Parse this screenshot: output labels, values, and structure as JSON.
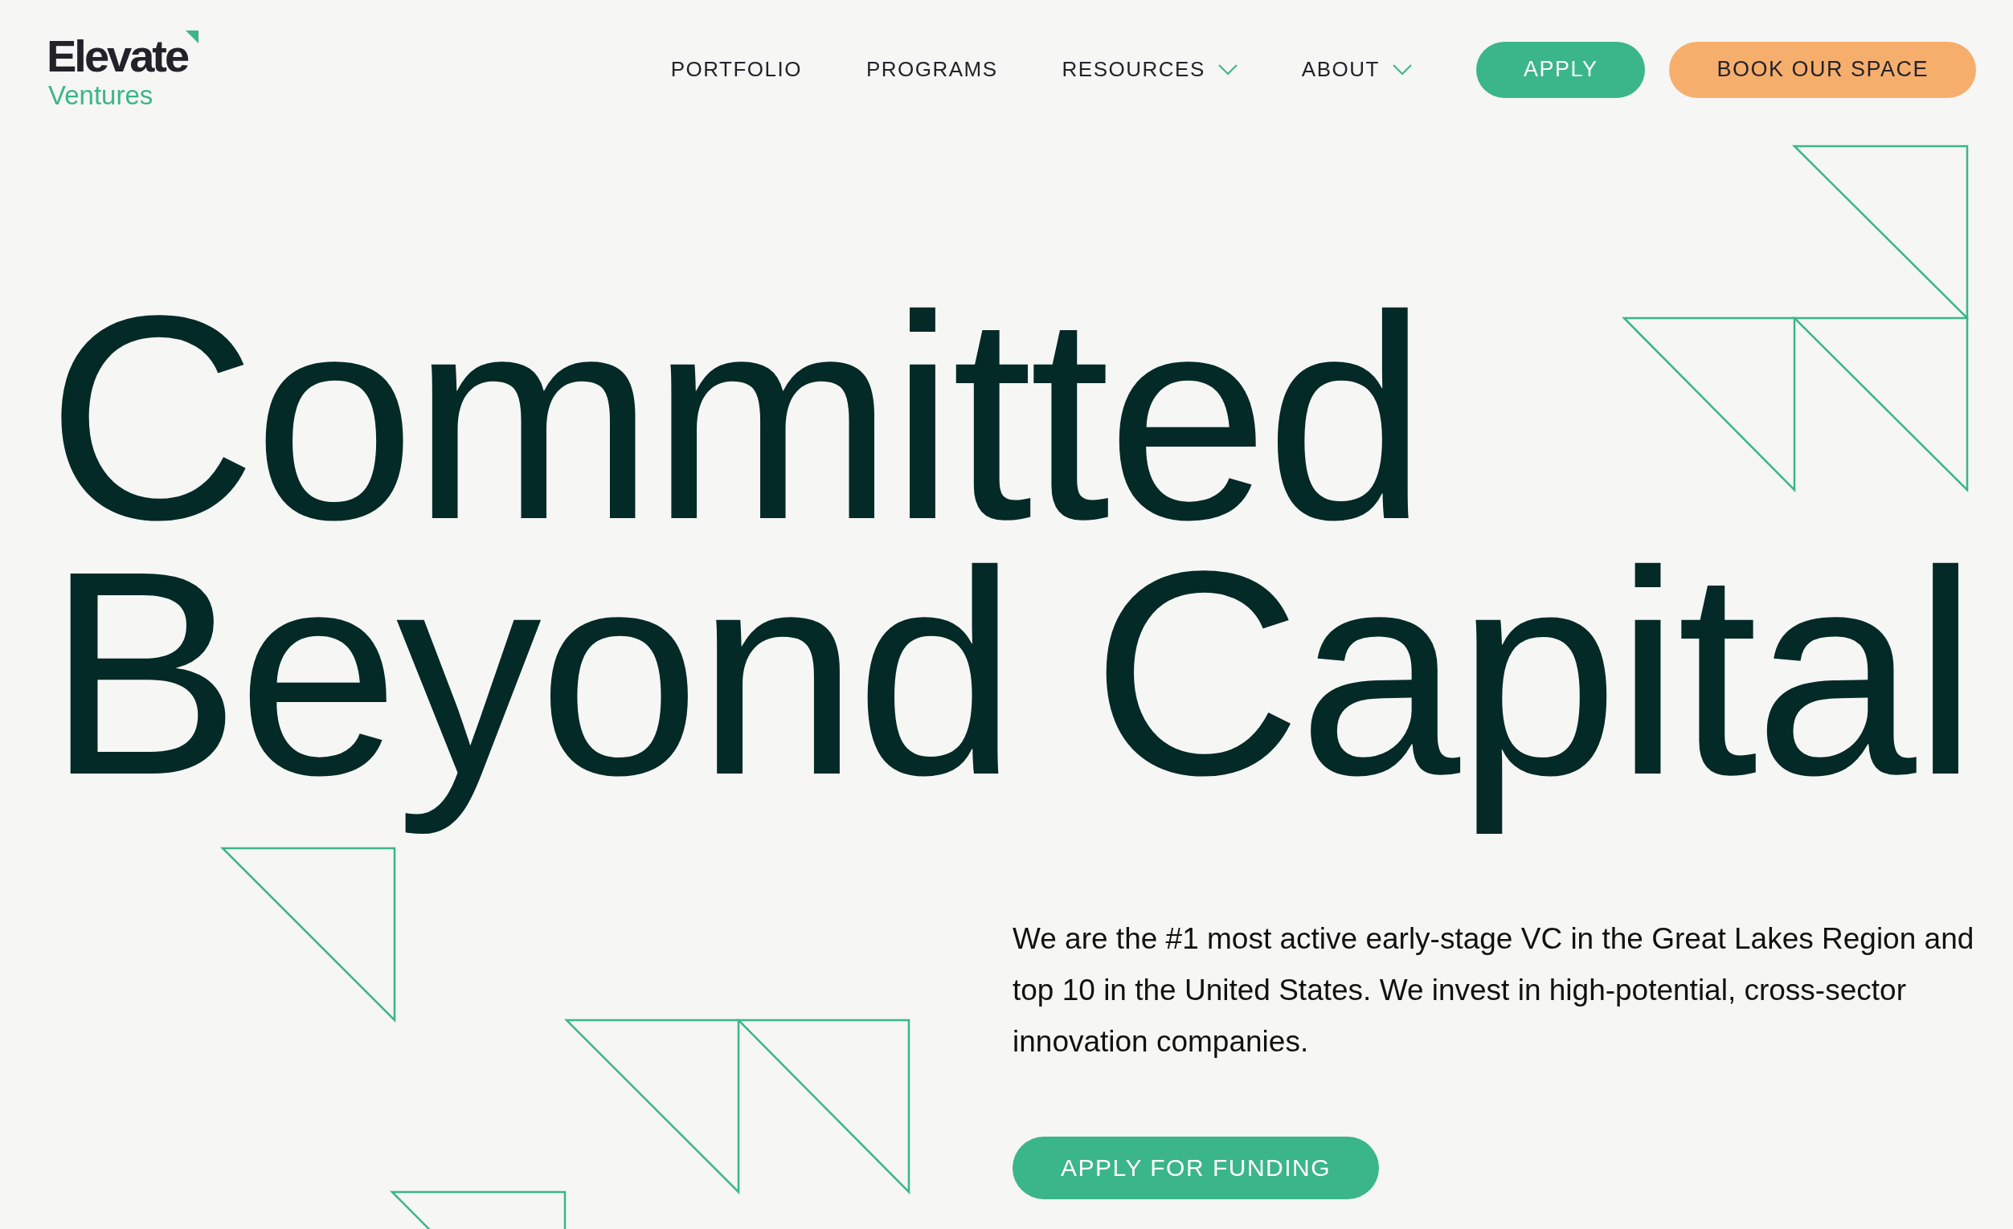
{
  "logo": {
    "name": "Elevate",
    "tagline": "Ventures"
  },
  "nav": {
    "links": [
      {
        "label": "PORTFOLIO",
        "has_dropdown": false
      },
      {
        "label": "PROGRAMS",
        "has_dropdown": false
      },
      {
        "label": "RESOURCES",
        "has_dropdown": true
      },
      {
        "label": "ABOUT",
        "has_dropdown": true
      }
    ],
    "buttons": [
      {
        "label": "APPLY",
        "kind": "primary"
      },
      {
        "label": "BOOK OUR SPACE",
        "kind": "secondary"
      }
    ]
  },
  "hero": {
    "headline_lines": [
      "Committed",
      "Beyond Capital"
    ],
    "description": "We are the #1 most active early-stage VC in the Great Lakes Region and top 10 in the United States. We invest in high-potential, cross-sector innovation companies.",
    "cta": "APPLY FOR FUNDING"
  }
}
